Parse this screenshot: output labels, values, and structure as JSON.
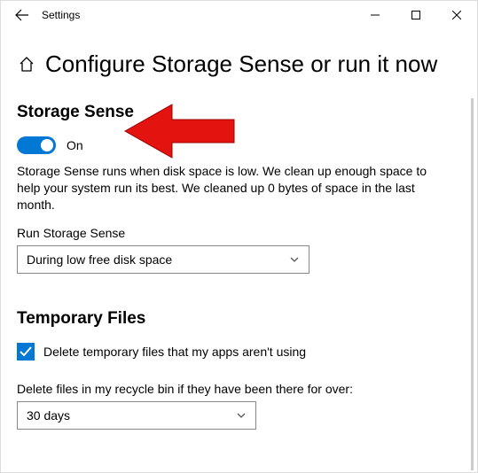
{
  "window": {
    "title": "Settings"
  },
  "page": {
    "title": "Configure Storage Sense or run it now"
  },
  "storageSense": {
    "sectionTitle": "Storage Sense",
    "toggleState": "On",
    "description": "Storage Sense runs when disk space is low. We clean up enough space to help your system run its best. We cleaned up 0 bytes of space in the last month.",
    "runLabel": "Run Storage Sense",
    "runValue": "During low free disk space"
  },
  "temporaryFiles": {
    "sectionTitle": "Temporary Files",
    "deleteTempChecked": true,
    "deleteTempLabel": "Delete temporary files that my apps aren't using",
    "recycleLabel": "Delete files in my recycle bin if they have been there for over:",
    "recycleValue": "30 days"
  },
  "icons": {
    "back": "back-arrow",
    "home": "home",
    "minimize": "minimize",
    "maximize": "maximize",
    "close": "close",
    "chevronDown": "chevron-down",
    "checkmark": "checkmark"
  }
}
